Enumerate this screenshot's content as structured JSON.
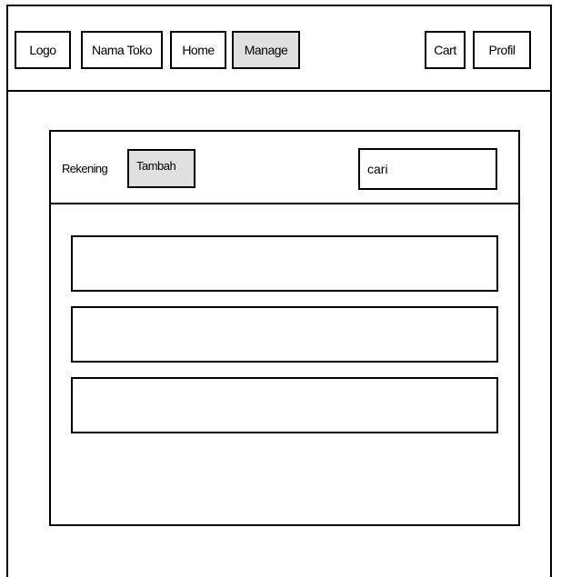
{
  "navbar": {
    "logo": "Logo",
    "store_name": "Nama Toko",
    "home": "Home",
    "manage": "Manage",
    "cart": "Cart",
    "profile": "Profil"
  },
  "panel": {
    "title": "Rekening",
    "add_button": "Tambah",
    "search": {
      "value": "cari",
      "placeholder": ""
    },
    "items": [
      "",
      "",
      ""
    ]
  }
}
